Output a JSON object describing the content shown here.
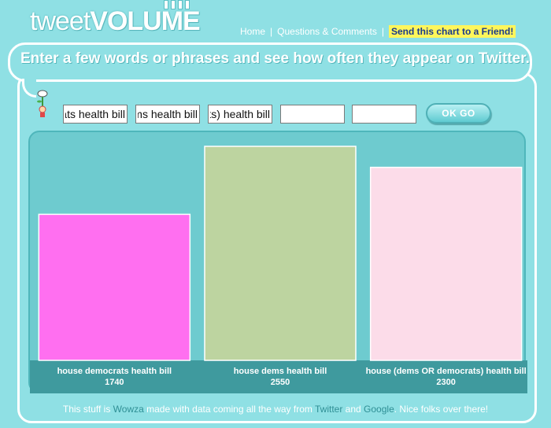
{
  "header": {
    "logo_light": "tweet",
    "logo_bold": "VOLUME",
    "nav": {
      "home": "Home",
      "questions": "Questions & Comments",
      "send": "Send this chart to a Friend!",
      "separator": "|"
    }
  },
  "headline": "Enter a few words or phrases and see how often they appear on Twitter.",
  "search": {
    "inputs": [
      "house democrats health bill",
      "house dems health bill",
      "house (dems OR democrats) health bill",
      "",
      ""
    ],
    "ok_label": "OK GO"
  },
  "chart_data": {
    "type": "bar",
    "categories": [
      "house democrats health bill",
      "house dems health bill",
      "house (dems OR democrats) health bill"
    ],
    "values": [
      1740,
      2550,
      2300
    ],
    "colors": [
      "#ff6ff0",
      "#bdd4a0",
      "#fcdce9"
    ],
    "ylim": [
      0,
      2550
    ]
  },
  "footer": {
    "pre": "This stuff is ",
    "wowza": "Wowza",
    "mid": " made with data coming all the way from ",
    "twitter": "Twitter",
    "and": " and ",
    "google": "Google",
    "post": ". Nice folks over there!"
  }
}
